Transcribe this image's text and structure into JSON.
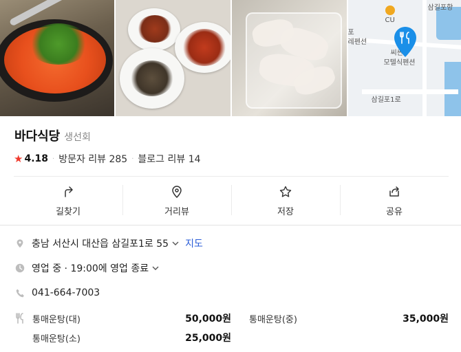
{
  "photos": [
    {
      "alt": "stew-photo"
    },
    {
      "alt": "side-dishes-photo"
    },
    {
      "alt": "raw-fish-photo"
    },
    {
      "alt": "map-thumbnail"
    }
  ],
  "map": {
    "labels": {
      "top_right": "삼길포항",
      "cu": "CU",
      "left1": "포",
      "left2": "레펜션",
      "place1": "씨싼",
      "place2": "모텔식펜션",
      "road": "삼길포1로"
    },
    "colors": {
      "pin": "#1a8fe8",
      "water": "#8ec3ea",
      "cu": "#f0a820"
    }
  },
  "place": {
    "name": "바다식당",
    "category": "생선회",
    "rating": "4.18",
    "visitor_reviews": "방문자 리뷰 285",
    "blog_reviews": "블로그 리뷰 14"
  },
  "actions": [
    {
      "label": "길찾기",
      "icon": "directions-icon"
    },
    {
      "label": "거리뷰",
      "icon": "street-view-icon"
    },
    {
      "label": "저장",
      "icon": "star-outline-icon"
    },
    {
      "label": "공유",
      "icon": "share-icon"
    }
  ],
  "info": {
    "address": "충남 서산시 대산읍 삼길포1로 55",
    "map_link": "지도",
    "hours": "영업 중 · 19:00에 영업 종료",
    "phone": "041-664-7003"
  },
  "menu": [
    {
      "name": "통매운탕(대)",
      "price": "50,000원"
    },
    {
      "name": "통매운탕(중)",
      "price": "35,000원"
    },
    {
      "name": "통매운탕(소)",
      "price": "25,000원"
    }
  ],
  "colors": {
    "accent_star": "#f03a2d",
    "link": "#2a5cd7"
  }
}
